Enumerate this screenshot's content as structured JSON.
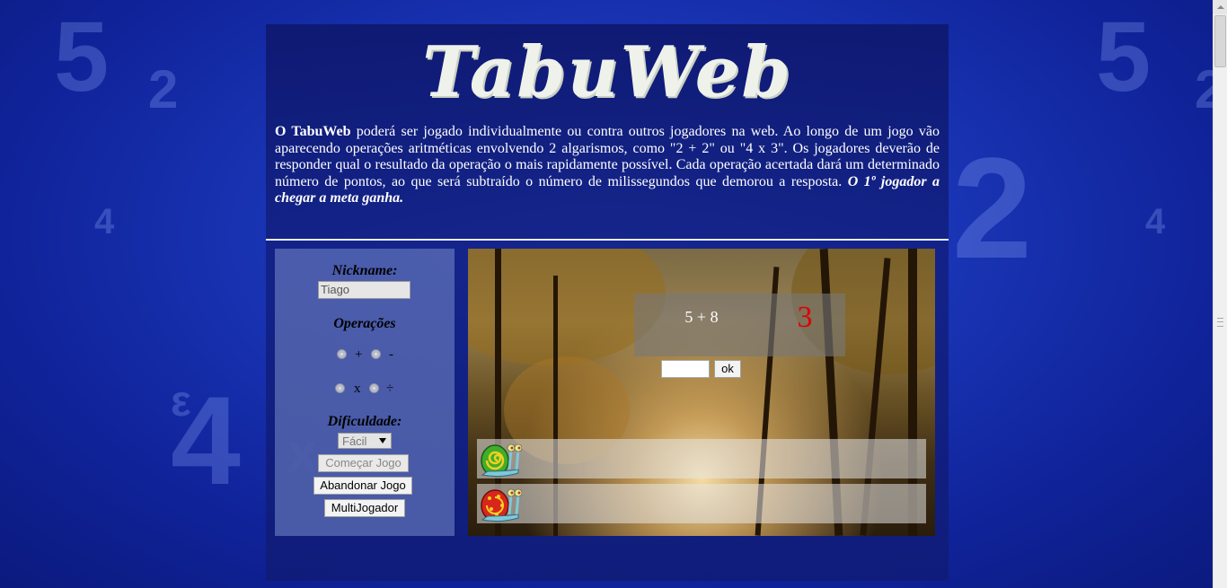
{
  "app": {
    "logo": "TabuWeb"
  },
  "intro": {
    "brand": "O TabuWeb",
    "text": " poderá ser jogado individualmente ou contra outros jogadores na web. Ao longo de um jogo vão aparecendo operações aritméticas envolvendo 2 algarismos, como \"2 + 2\" ou \"4 x 3\". Os jogadores deverão de responder qual o resultado da operação o mais rapidamente possível. Cada operação acertada dará um determinado número de pontos, ao que será subtraído o número de milissegundos que demorou a resposta. ",
    "goal": "O 1º jogador a chegar a meta ganha."
  },
  "settings": {
    "nickname_label": "Nickname:",
    "nickname_value": "Tiago",
    "operations_label": "Operações",
    "ops": [
      "+",
      "-",
      "x",
      "÷"
    ],
    "difficulty_label": "Dificuldade:",
    "difficulty_value": "Fácil",
    "start_button": "Começar Jogo",
    "quit_button": "Abandonar Jogo",
    "multi_button": "MultiJogador"
  },
  "game": {
    "operation": "5 + 8",
    "timer": "3",
    "answer_value": "",
    "ok_button": "ok",
    "players": [
      {
        "icon": "green-snail-icon",
        "color": "#3fae2a"
      },
      {
        "icon": "red-snail-icon",
        "color": "#d9261c"
      }
    ]
  },
  "colors": {
    "background": "#1a37b8",
    "timer": "#e00000"
  }
}
